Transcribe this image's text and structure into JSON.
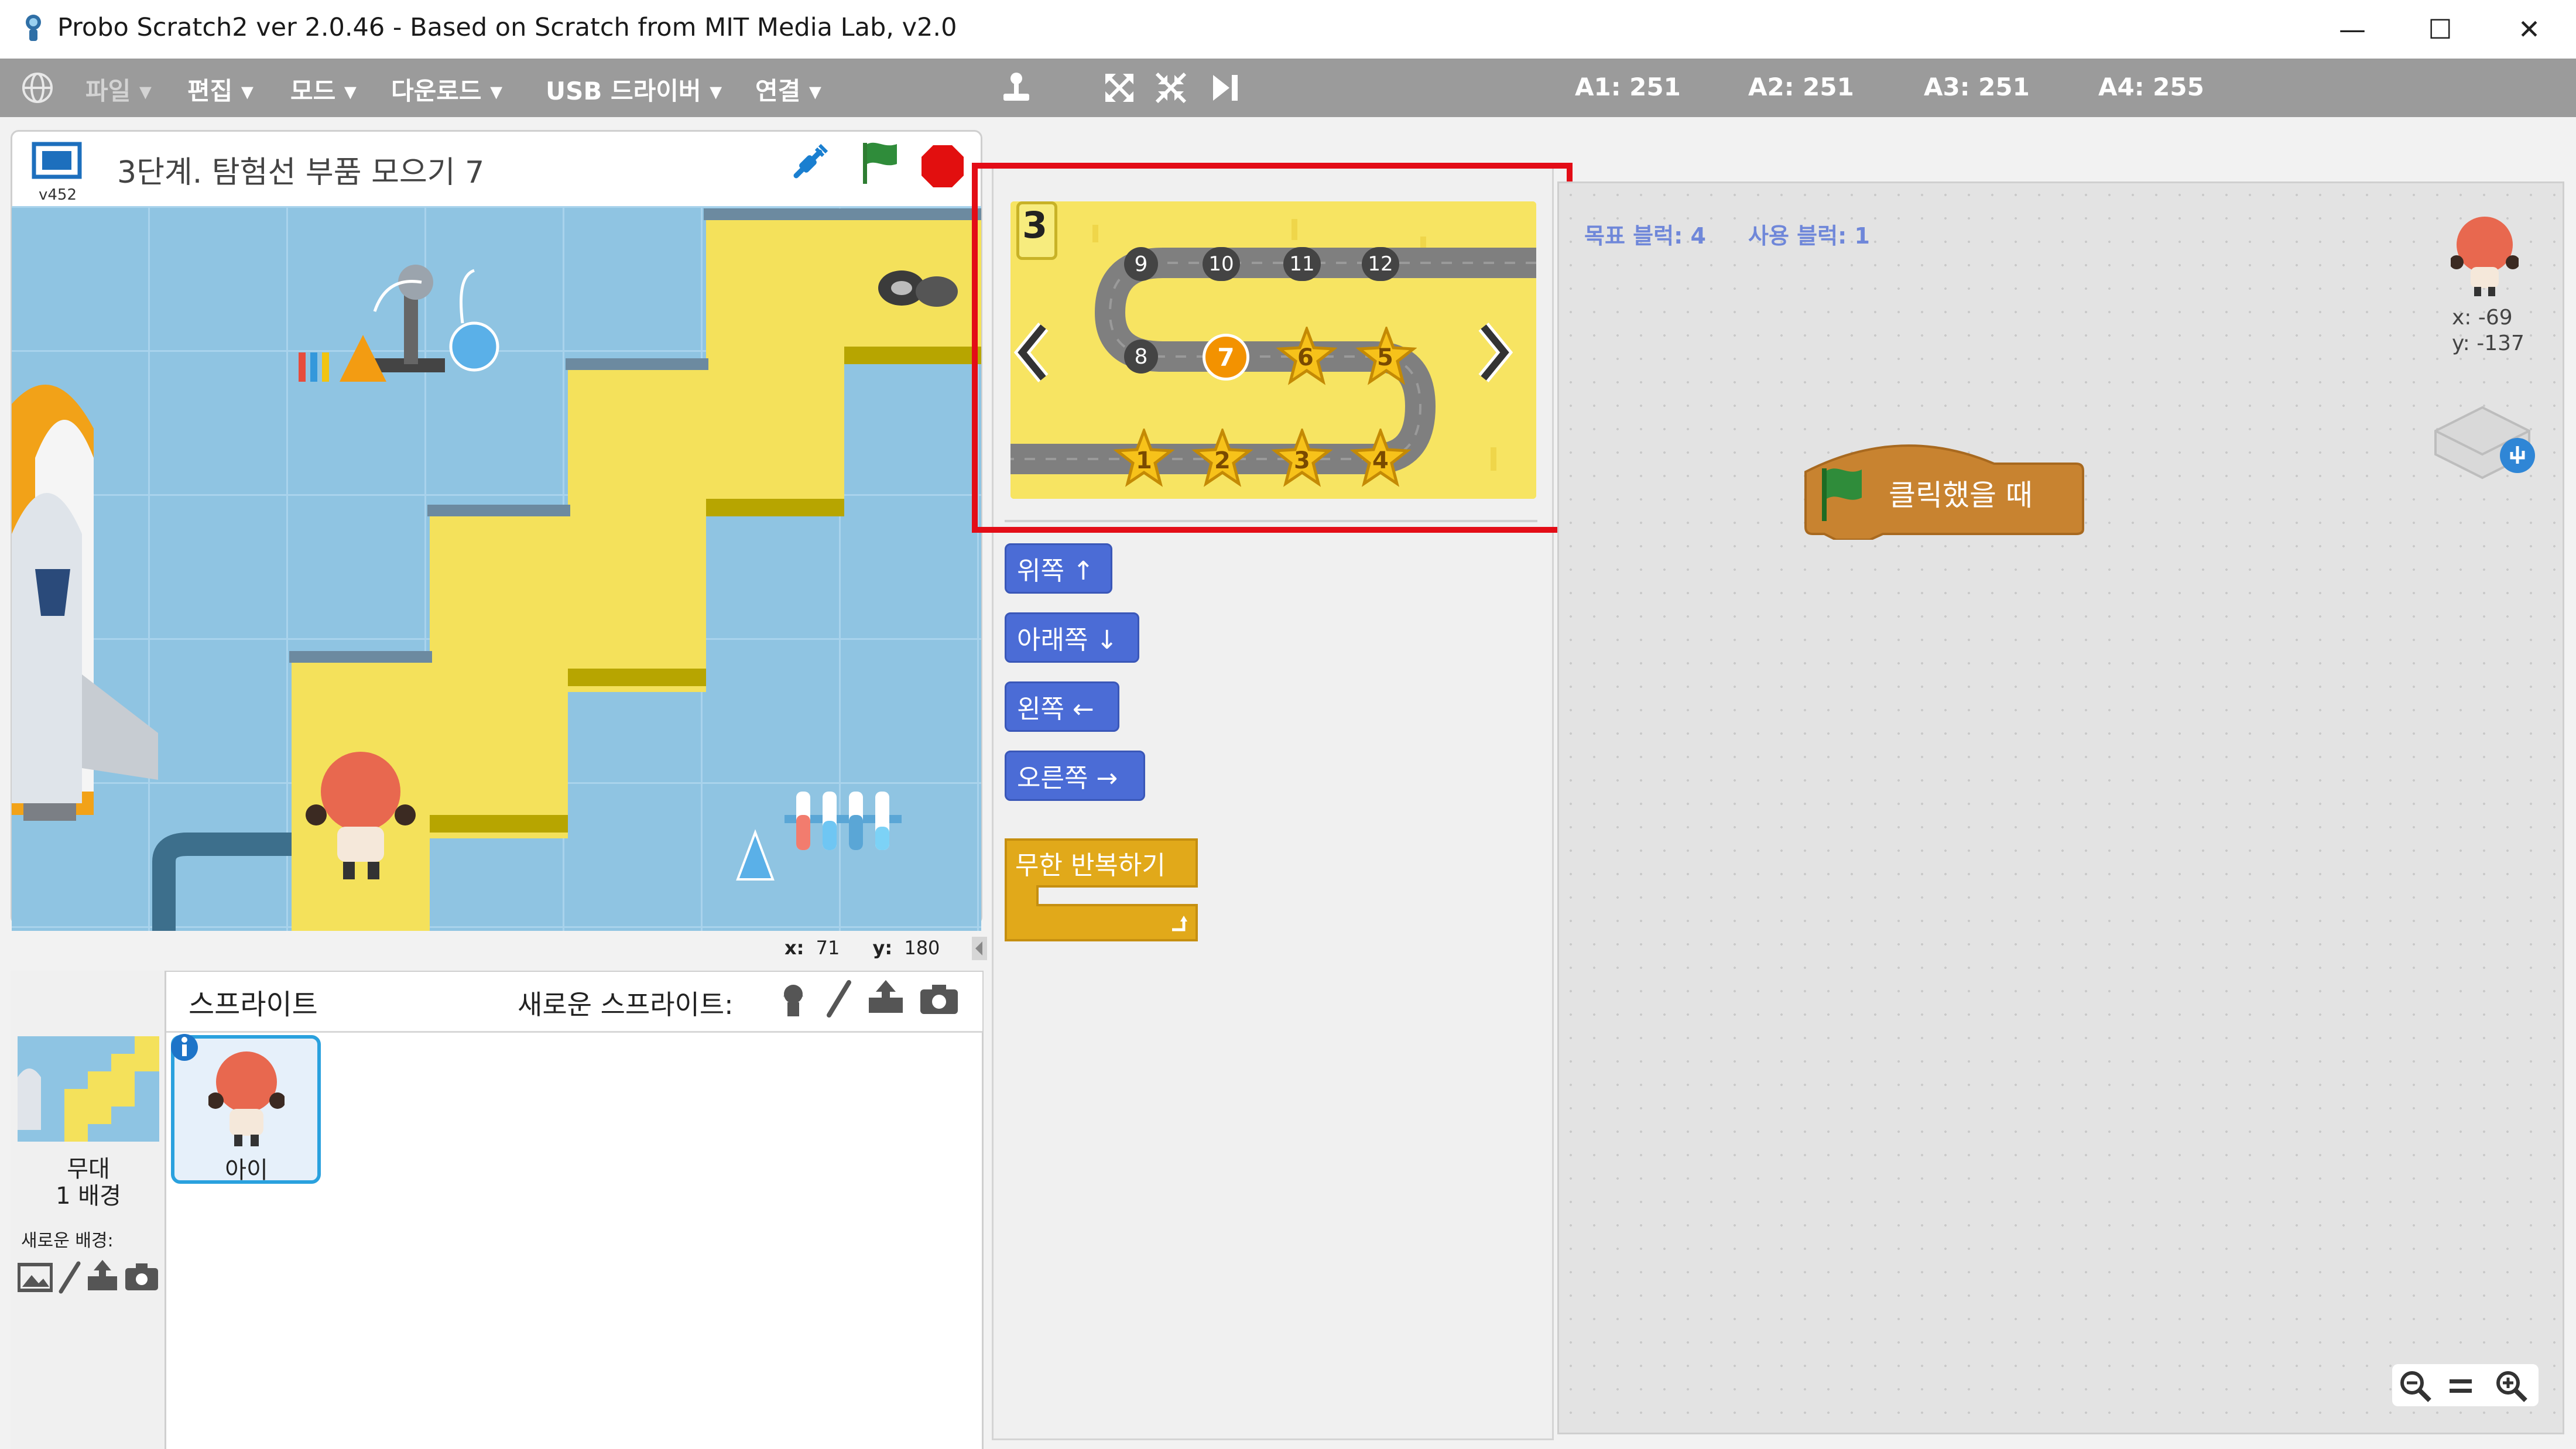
{
  "window": {
    "title": "Probo Scratch2 ver 2.0.46 - Based on Scratch from MIT Media Lab, v2.0",
    "minimize": "—",
    "maximize": "☐",
    "close": "✕"
  },
  "menubar": {
    "items": [
      {
        "label": "파일 ▾",
        "enabled": false
      },
      {
        "label": "편집 ▾",
        "enabled": true
      },
      {
        "label": "모드 ▾",
        "enabled": true
      },
      {
        "label": "다운로드 ▾",
        "enabled": true
      },
      {
        "label": "USB 드라이버 ▾",
        "enabled": true
      },
      {
        "label": "연결 ▾",
        "enabled": true
      }
    ],
    "sensors": [
      "A1: 251",
      "A2: 251",
      "A3: 251",
      "A4: 255"
    ]
  },
  "stage": {
    "version": "v452",
    "project_title": "3단계. 탐험선 부품 모으기 7",
    "mouse_x_label": "x:",
    "mouse_x": "71",
    "mouse_y_label": "y:",
    "mouse_y": "180"
  },
  "sprites": {
    "header": "스프라이트",
    "new_sprite_label": "새로운 스프라이트:",
    "stage_name": "무대",
    "backdrop_count": "1 배경",
    "new_backdrop_label": "새로운 배경:",
    "list": [
      {
        "name": "아이",
        "selected": true
      }
    ]
  },
  "level_map": {
    "current_level": "3",
    "stations_top": [
      "9",
      "10",
      "11",
      "12"
    ],
    "stations_mid": [
      "8",
      "7",
      "6",
      "5"
    ],
    "stations_bottom": [
      "1",
      "2",
      "3",
      "4"
    ],
    "current_station": "7"
  },
  "palette": {
    "blocks": [
      "위쪽 ↑",
      "아래쪽 ↓",
      "왼쪽 ←",
      "오른쪽 →"
    ],
    "loop_block": "무한 반복하기"
  },
  "script_area": {
    "target_label": "목표 블럭: 4",
    "used_label": "사용 블럭: 1",
    "hat_block": "클릭했을 때",
    "sprite_x": "x: -69",
    "sprite_y": "y: -137",
    "zoom_out": "−",
    "zoom_reset": "=",
    "zoom_in": "+"
  },
  "colors": {
    "menubar": "#9b9b9b",
    "motion_block": "#4b6cd6",
    "control_block": "#e1a91a",
    "event_block": "#c88330",
    "highlight": "#e30d17",
    "stage_sky": "#8ec4e3",
    "path_yellow": "#f7e462"
  }
}
